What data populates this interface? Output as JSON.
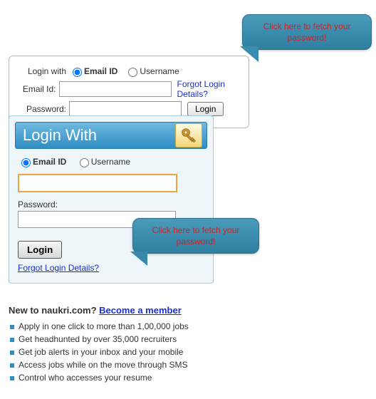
{
  "callout": {
    "text": "Click here to fetch your password!"
  },
  "colors": {
    "accent": "#3b8daf",
    "link": "#1a2fce",
    "highlight": "#e9a53f",
    "callout_text": "#c22"
  },
  "box1": {
    "login_with": "Login with",
    "radio_email": "Email ID",
    "radio_username": "Username",
    "email_label": "Email Id:",
    "password_label": "Password:",
    "forgot": "Forgot Login Details?",
    "login_btn": "Login"
  },
  "box2": {
    "title": "Login With",
    "key_icon": "key-icon",
    "radio_email": "Email ID",
    "radio_username": "Username",
    "password_label": "Password:",
    "login_btn": "Login",
    "forgot": "Forgot Login Details?"
  },
  "box3": {
    "heading_prefix": "New to naukri.com? ",
    "heading_link": "Become a member",
    "bullets": [
      "Apply in one click to more than 1,00,000 jobs",
      "Get headhunted by over 35,000 recruiters",
      "Get job alerts in your inbox and your mobile",
      "Access jobs while on the move through SMS",
      "Control who accesses your resume"
    ]
  }
}
